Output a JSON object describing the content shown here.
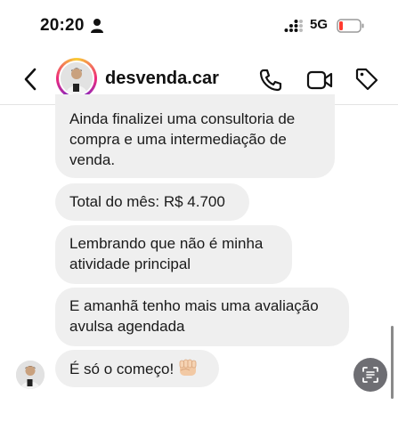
{
  "status_bar": {
    "time": "20:20",
    "network": "5G",
    "icons": [
      "person-icon",
      "signal-icon",
      "battery-icon"
    ]
  },
  "header": {
    "contact_name": "desvenda.car",
    "icons": [
      "back-icon",
      "call-icon",
      "video-icon",
      "tag-icon"
    ]
  },
  "messages": [
    {
      "text": "Ainda finalizei  uma consultoria de\ncompra e uma intermediação de\nvenda."
    },
    {
      "text": "Total do mês: R$ 4.700"
    },
    {
      "text": "Lembrando que não é minha\natividade principal"
    },
    {
      "text": "E amanhã tenho mais uma avaliação\navulsa agendada"
    },
    {
      "text": "É só o começo!",
      "emoji": "raised-fist-icon"
    }
  ],
  "colors": {
    "bubble": "#efefef",
    "battery_low": "#ff3b30",
    "scan_button": "#6e6e73"
  }
}
